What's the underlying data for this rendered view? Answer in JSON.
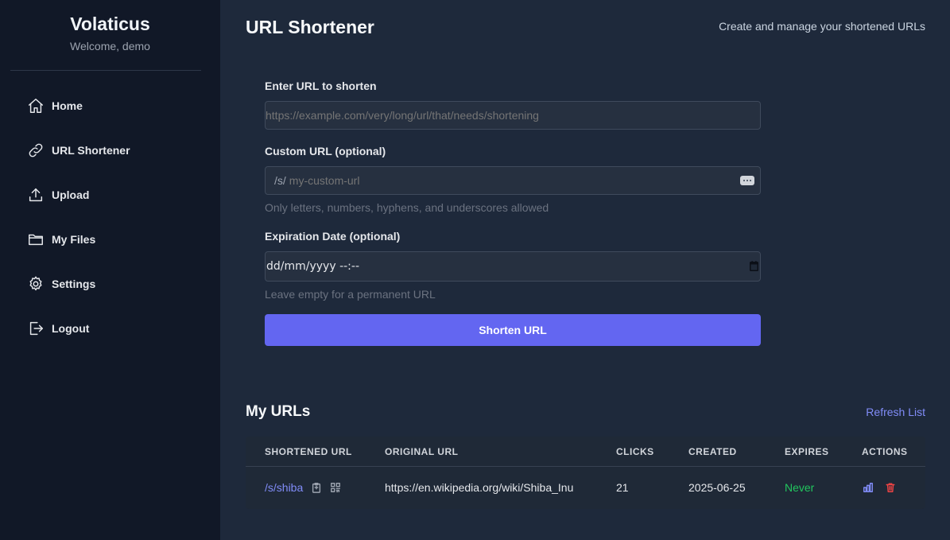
{
  "app": {
    "title": "Volaticus",
    "welcome": "Welcome, demo"
  },
  "sidebar": {
    "items": [
      {
        "label": "Home",
        "icon": "home-icon"
      },
      {
        "label": "URL Shortener",
        "icon": "link-icon"
      },
      {
        "label": "Upload",
        "icon": "upload-icon"
      },
      {
        "label": "My Files",
        "icon": "folder-icon"
      },
      {
        "label": "Settings",
        "icon": "gear-icon"
      },
      {
        "label": "Logout",
        "icon": "logout-icon"
      }
    ]
  },
  "header": {
    "title": "URL Shortener",
    "subtitle": "Create and manage your shortened URLs"
  },
  "form": {
    "url_label": "Enter URL to shorten",
    "url_placeholder": "https://example.com/very/long/url/that/needs/shortening",
    "custom_label": "Custom URL (optional)",
    "custom_prefix": "/s/",
    "custom_placeholder": "my-custom-url",
    "custom_hint": "Only letters, numbers, hyphens, and underscores allowed",
    "expiry_label": "Expiration Date (optional)",
    "expiry_value": "dd/mm/yyyy --:--",
    "expiry_hint": "Leave empty for a permanent URL",
    "submit_label": "Shorten URL"
  },
  "urls": {
    "title": "My URLs",
    "refresh_label": "Refresh List",
    "columns": [
      "SHORTENED URL",
      "ORIGINAL URL",
      "CLICKS",
      "CREATED",
      "EXPIRES",
      "ACTIONS"
    ],
    "rows": [
      {
        "short": "/s/shiba",
        "original": "https://en.wikipedia.org/wiki/Shiba_Inu",
        "clicks": "21",
        "created": "2025-06-25",
        "expires": "Never"
      }
    ]
  },
  "colors": {
    "accent": "#6366f1",
    "link": "#818cf8",
    "success": "#22c55e",
    "danger": "#ef4444",
    "sidebar_bg": "#111827",
    "main_bg": "#1e293b"
  }
}
